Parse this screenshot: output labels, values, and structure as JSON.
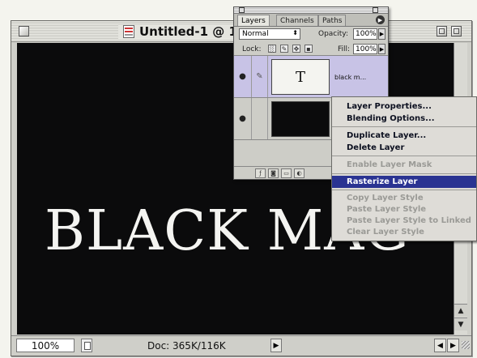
{
  "document": {
    "title": "Untitled-1 @ 10",
    "headline": "BLACK MAG",
    "zoom": "100%",
    "doc_size": "Doc: 365K/116K"
  },
  "layers_palette": {
    "tabs": [
      "Layers",
      "Channels",
      "Paths"
    ],
    "blend_mode": "Normal",
    "opacity_label": "Opacity:",
    "opacity_value": "100%",
    "lock_label": "Lock:",
    "fill_label": "Fill:",
    "fill_value": "100%",
    "layers": [
      {
        "thumb_text": "T",
        "name": "black m...",
        "selected": true
      },
      {
        "thumb_text": "",
        "name": "",
        "selected": false
      }
    ]
  },
  "context_menu": {
    "items": [
      {
        "label": "Layer Properties...",
        "enabled": true
      },
      {
        "label": "Blending Options...",
        "enabled": true
      },
      {
        "label": "Duplicate Layer...",
        "enabled": true
      },
      {
        "label": "Delete Layer",
        "enabled": true
      },
      {
        "label": "Enable Layer Mask",
        "enabled": false
      },
      {
        "label": "Rasterize Layer",
        "enabled": true,
        "highlighted": true
      },
      {
        "label": "Copy Layer Style",
        "enabled": false
      },
      {
        "label": "Paste Layer Style",
        "enabled": false
      },
      {
        "label": "Paste Layer Style to Linked",
        "enabled": false
      },
      {
        "label": "Clear Layer Style",
        "enabled": false
      }
    ]
  },
  "colors": {
    "canvas": "#0b0b0c",
    "menu_highlight": "#2a3392",
    "selected_layer": "#c8c3e6"
  }
}
